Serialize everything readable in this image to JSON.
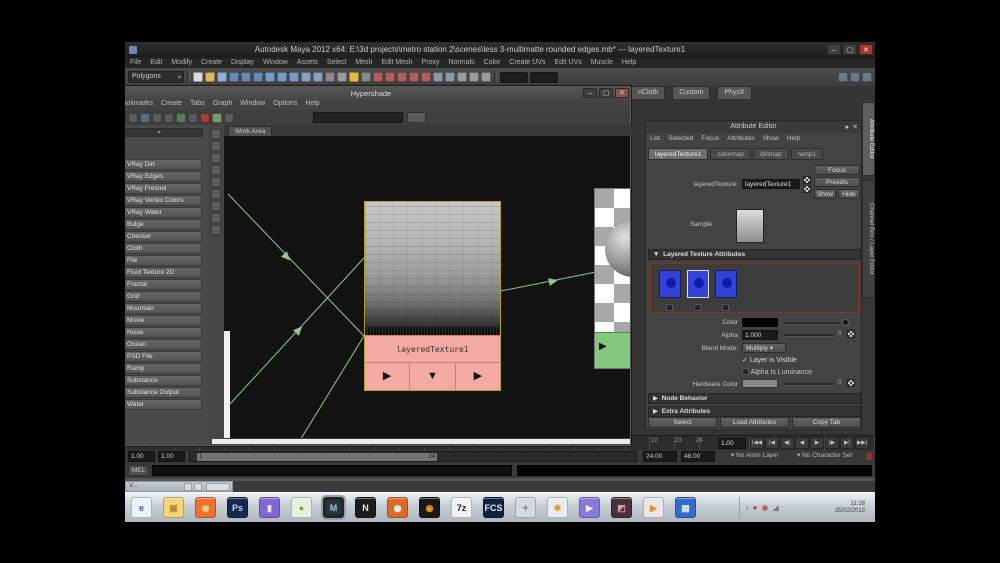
{
  "ui": {
    "caret": "▾",
    "tri_right": "▶",
    "tri_down": "▼",
    "check": "✓",
    "collapse_open": "▼",
    "collapse_closed": "▶",
    "pin": "●",
    "close": "✕",
    "min": "–",
    "max": "▢"
  },
  "window": {
    "title": "Autodesk Maya 2012 x64: E:\\3d projects\\metro station 2\\scenes\\less 3-multimatte rounded edges.mb*    ---    layeredTexture1",
    "menus": [
      "File",
      "Edit",
      "Modify",
      "Create",
      "Display",
      "Window",
      "Assets",
      "Select",
      "Mesh",
      "Edit Mesh",
      "Proxy",
      "Normals",
      "Color",
      "Create UVs",
      "Edit UVs",
      "Muscle",
      "Help"
    ],
    "mode": "Polygons",
    "status_icons": [
      {
        "name": "new-scene-icon",
        "color": "#dcdcdc"
      },
      {
        "name": "open-scene-icon",
        "color": "#d8b860"
      },
      {
        "name": "save-scene-icon",
        "color": "#90b0d8"
      },
      {
        "name": "select-by-hierarchy-icon",
        "color": "#6888b8"
      },
      {
        "name": "select-by-object-icon",
        "color": "#6888b8"
      },
      {
        "name": "select-by-component-icon",
        "color": "#6888b8"
      },
      {
        "name": "move-tool-icon",
        "color": "#7898c8"
      },
      {
        "name": "rotate-tool-icon",
        "color": "#7898c8"
      },
      {
        "name": "scale-tool-icon",
        "color": "#7898c8"
      },
      {
        "name": "lasso-tool-icon",
        "color": "#88a0c0"
      },
      {
        "name": "paint-select-icon",
        "color": "#88a0c0"
      },
      {
        "name": "soft-select-icon",
        "color": "#8a8a8a"
      },
      {
        "name": "question-icon",
        "color": "#9a9a9a"
      },
      {
        "name": "lock-icon",
        "color": "#e0c040"
      },
      {
        "name": "highlight-icon",
        "color": "#8a8a8a"
      },
      {
        "name": "snap-grid-icon",
        "color": "#b06060"
      },
      {
        "name": "snap-curve-icon",
        "color": "#b06060"
      },
      {
        "name": "snap-point-icon",
        "color": "#b06060"
      },
      {
        "name": "snap-plane-icon",
        "color": "#b06060"
      },
      {
        "name": "snap-surface-icon",
        "color": "#b06060"
      },
      {
        "name": "history-icon",
        "color": "#8a9aa8"
      },
      {
        "name": "construction-icon",
        "color": "#8a9aa8"
      },
      {
        "name": "render-icon",
        "color": "#9a9a9a"
      },
      {
        "name": "ipr-render-icon",
        "color": "#9a9a9a"
      },
      {
        "name": "render-settings-icon",
        "color": "#9a9a9a"
      }
    ],
    "right_icons": [
      {
        "name": "sidebar-toggle-icon",
        "color": "#6a7a8a"
      },
      {
        "name": "channelbox-toggle-icon",
        "color": "#6a7a8a"
      },
      {
        "name": "attreditor-toggle-icon",
        "color": "#6a7a8a"
      }
    ]
  },
  "hypershade": {
    "title": "Hypershade",
    "menus": [
      "Bookmarks",
      "Create",
      "Tabs",
      "Graph",
      "Window",
      "Options",
      "Help"
    ],
    "tab": "Work Area",
    "node_label": "layeredTexture1",
    "toolbar_icons": [
      {
        "name": "previous-graph-icon",
        "color": "#5c5c5c"
      },
      {
        "name": "next-graph-icon",
        "color": "#5c5c5c"
      },
      {
        "name": "create-bar-icon",
        "color": "#5c6c7c"
      },
      {
        "name": "clear-graph-icon",
        "color": "#5c5c5c"
      },
      {
        "name": "rearrange-graph-icon",
        "color": "#5c5c5c"
      },
      {
        "name": "graph-material-icon",
        "color": "#5c7a5c"
      },
      {
        "name": "input-connections-icon",
        "color": "#5c5c5c"
      },
      {
        "name": "output-connections-icon",
        "color": "#a04040"
      },
      {
        "name": "input-output-connections-icon",
        "color": "#7a9a6a"
      },
      {
        "name": "show-connected-icon",
        "color": "#5c5c5c"
      }
    ],
    "vstrip_icons": [
      {
        "name": "materials-tab-icon",
        "color": "#5e5e5e"
      },
      {
        "name": "textures-tab-icon",
        "color": "#5e5e5e"
      },
      {
        "name": "utilities-tab-icon",
        "color": "#5e5e5e"
      },
      {
        "name": "lights-tab-icon",
        "color": "#5e5e5e"
      },
      {
        "name": "cameras-tab-icon",
        "color": "#5e5e5e"
      },
      {
        "name": "shading-groups-icon",
        "color": "#5e5e5e"
      },
      {
        "name": "bake-sets-icon",
        "color": "#5e5e5e"
      },
      {
        "name": "projects-icon",
        "color": "#5e5e5e"
      },
      {
        "name": "asset-icon",
        "color": "#5e5e5e"
      }
    ],
    "create_list": [
      {
        "label": "VRay Dirt",
        "color": "#3a3a3a"
      },
      {
        "label": "VRay Edges",
        "color": "#1e4020"
      },
      {
        "label": "VRay Fresnel",
        "color": "#4a72c8"
      },
      {
        "label": "VRay Vertex Colors",
        "color": "#a048c0"
      },
      {
        "label": "VRay Water",
        "color": "#b8c4cc"
      },
      {
        "label": "Bulge",
        "color": "#d0d0d0"
      },
      {
        "label": "Checker",
        "color": "#e8e8e8"
      },
      {
        "label": "Cloth",
        "color": "#c0c0c0"
      },
      {
        "label": "File",
        "color": "#3f8a3f"
      },
      {
        "label": "Fluid Texture 2D",
        "color": "#3858b8"
      },
      {
        "label": "Fractal",
        "color": "#909090"
      },
      {
        "label": "Grid",
        "color": "#c8c8c8"
      },
      {
        "label": "Mountain",
        "color": "#a87038"
      },
      {
        "label": "Movie",
        "color": "#6070c0"
      },
      {
        "label": "Noise",
        "color": "#989898"
      },
      {
        "label": "Ocean",
        "color": "#2860b8"
      },
      {
        "label": "PSD File",
        "color": "#6a9a40"
      },
      {
        "label": "Ramp",
        "color": "#c84040"
      },
      {
        "label": "Substance",
        "color": "#b04040"
      },
      {
        "label": "Substance Output",
        "color": "#a03838"
      },
      {
        "label": "Water",
        "color": "#3888c8"
      }
    ]
  },
  "attribute_editor": {
    "shelf_tabs": [
      "nCloth",
      "Custom",
      "PhysX"
    ],
    "title": "Attribute Editor",
    "menus": [
      "List",
      "Selected",
      "Focus",
      "Attributes",
      "Show",
      "Help"
    ],
    "tabs": [
      {
        "label": "layeredTexture1",
        "active": true
      },
      {
        "label": "colormap"
      },
      {
        "label": "dirtmap"
      },
      {
        "label": "ramp1"
      }
    ],
    "focus": "Focus",
    "presets": "Presets",
    "show": "Show",
    "hide": "Hide",
    "name_label": "layeredTexture:",
    "name_value": "layeredTexture1",
    "sample": "Sample",
    "section_layered": "Layered Texture Attributes",
    "color_label": "Color",
    "alpha_label": "Alpha",
    "alpha_value": "1.000",
    "alpha_right": "0",
    "blend_label": "Blend Mode:",
    "blend_value": "Multiply",
    "layer_visible": "Layer is Visible",
    "alpha_luminance": "Alpha Is Luminance",
    "hw_label": "Hardware Color",
    "hw_right": "0",
    "node_behavior": "Node Behavior",
    "extra_attrs": "Extra Attributes",
    "buttons": [
      "Select",
      "Load Attributes",
      "Copy Tab"
    ],
    "side_tabs": [
      {
        "label": "Attribute Editor",
        "active": true
      },
      {
        "label": "Channel Box / Layer Editor"
      }
    ]
  },
  "timeline": {
    "tick_labels": [
      "22",
      "23",
      "24"
    ],
    "current": "1.00",
    "play_buttons": [
      "|◀◀",
      "|◀",
      "◀|",
      "◀",
      "▶",
      "|▶",
      "▶|",
      "▶▶|"
    ],
    "rs1": "1.00",
    "rs2": "1.00",
    "bar_start": "1",
    "bar_end": "24",
    "end": "24.00",
    "max": "48.00",
    "anim_layer": "No Anim Layer",
    "char_set": "No Character Set"
  },
  "command": {
    "mel": "MEL"
  },
  "taskbar": {
    "minimized_title": "V...",
    "icons": [
      {
        "name": "internet-explorer-icon",
        "glyph": "e",
        "bg": "#eaf2fb",
        "fg": "#2a66c8"
      },
      {
        "name": "folder-icon",
        "glyph": "▣",
        "bg": "#f3d57a",
        "fg": "#b08a2a"
      },
      {
        "name": "firefox-icon",
        "glyph": "◉",
        "bg": "#f07030",
        "fg": "#ffd080"
      },
      {
        "name": "photoshop-icon",
        "glyph": "Ps",
        "bg": "#16294f",
        "fg": "#bcd3f5"
      },
      {
        "name": "purple-app-icon",
        "glyph": "▮",
        "bg": "#8066d0",
        "fg": "#e8e4f8"
      },
      {
        "name": "green-orb-icon",
        "glyph": "●",
        "bg": "#e8f0e4",
        "fg": "#55b838"
      },
      {
        "name": "maya-icon",
        "glyph": "M",
        "bg": "#30343a",
        "fg": "#8fd0d8",
        "active": true
      },
      {
        "name": "nuke-icon",
        "glyph": "N",
        "bg": "#1c1c1c",
        "fg": "#e8e8e8"
      },
      {
        "name": "blender-icon",
        "glyph": "◉",
        "bg": "#d86a2a",
        "fg": "#f8f8f8"
      },
      {
        "name": "toxik-icon",
        "glyph": "◉",
        "bg": "#181818",
        "fg": "#f0a020"
      },
      {
        "name": "7zip-icon",
        "glyph": "7z",
        "bg": "#f2f2f2",
        "fg": "#222222"
      },
      {
        "name": "fcs-icon",
        "glyph": "FCS",
        "bg": "#0f2040",
        "fg": "#e8e8e8"
      },
      {
        "name": "silver-app-icon",
        "glyph": "✦",
        "bg": "#d6dade",
        "fg": "#8a9098"
      },
      {
        "name": "gold-paint-icon",
        "glyph": "✱",
        "bg": "#e9edf1",
        "fg": "#d8a020"
      },
      {
        "name": "kmplayer-icon",
        "glyph": "▶",
        "bg": "#8a7ad8",
        "fg": "#f0f0f8"
      },
      {
        "name": "photo-viewer-icon",
        "glyph": "◩",
        "bg": "#4a3038",
        "fg": "#c8a0a8"
      },
      {
        "name": "media-player-icon",
        "glyph": "▶",
        "bg": "#e8e8e8",
        "fg": "#f08820"
      },
      {
        "name": "blue-app-icon",
        "glyph": "▦",
        "bg": "#3a6ac8",
        "fg": "#d8e8f8"
      }
    ],
    "tray": [
      {
        "name": "tray-expand-icon",
        "glyph": "‹",
        "fg": "#5a6068"
      },
      {
        "name": "tray-badge-icon",
        "glyph": "●",
        "fg": "#c04040"
      },
      {
        "name": "tray-badge2-icon",
        "glyph": "◉",
        "fg": "#b05050"
      },
      {
        "name": "tray-audio-icon",
        "glyph": "◢",
        "fg": "#707880"
      }
    ],
    "time": "11:28",
    "date": "25/02/2013"
  }
}
